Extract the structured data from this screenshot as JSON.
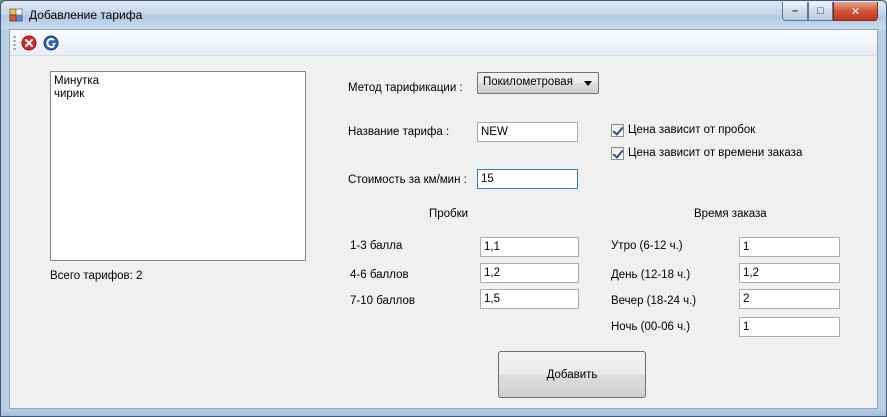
{
  "window": {
    "title": "Добавление тарифа",
    "controls": {
      "minimize": "–",
      "maximize": "□",
      "close": "✕"
    }
  },
  "toolbar": {
    "items": [
      {
        "icon": "close-red-icon"
      },
      {
        "icon": "refresh-back-icon"
      }
    ]
  },
  "tariff_list": {
    "items": [
      "Минутка",
      "чирик"
    ],
    "total_label": "Всего тарифов: 2"
  },
  "form": {
    "method_label": "Метод тарификации :",
    "method_value": "Покилометровая",
    "name_label": "Название тарифа :",
    "name_value": "NEW",
    "cost_label": "Стоимость за км/мин :",
    "cost_value": "15",
    "checkbox_traffic": {
      "label": "Цена зависит от пробок",
      "checked": true
    },
    "checkbox_time": {
      "label": "Цена зависит от времени заказа",
      "checked": true
    }
  },
  "traffic": {
    "header": "Пробки",
    "rows": [
      {
        "label": "1-3 балла",
        "value": "1,1"
      },
      {
        "label": "4-6 баллов",
        "value": "1,2"
      },
      {
        "label": "7-10 баллов",
        "value": "1,5"
      }
    ]
  },
  "order_time": {
    "header": "Время заказа",
    "rows": [
      {
        "label": "Утро (6-12 ч.)",
        "value": "1"
      },
      {
        "label": "День (12-18 ч.)",
        "value": "1,2"
      },
      {
        "label": "Вечер (18-24 ч.)",
        "value": "2"
      },
      {
        "label": "Ночь (00-06 ч.)",
        "value": "1"
      }
    ]
  },
  "add_button_label": "Добавить",
  "colors": {
    "title_bar": "#c4d6ea",
    "client_bg": "#f0f0f0",
    "close_button": "#c0391d",
    "focus_border": "#3c7fb1"
  }
}
